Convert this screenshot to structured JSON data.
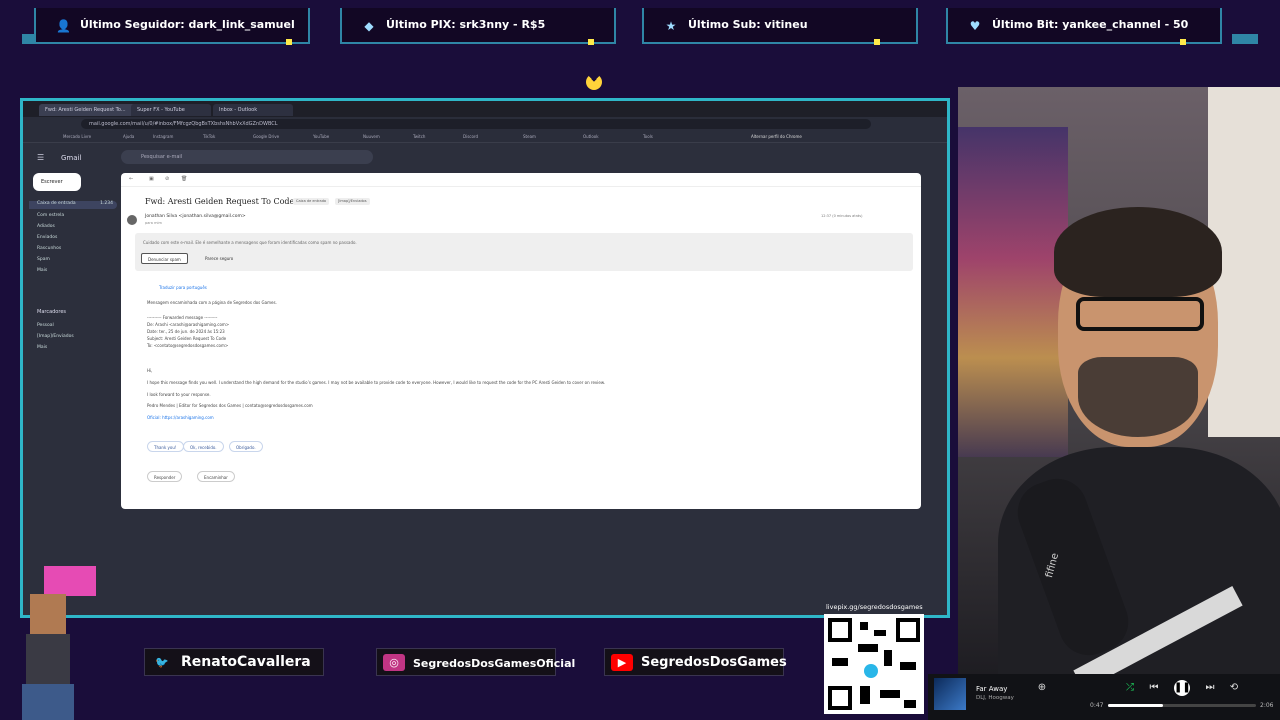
{
  "overlay": {
    "tickers": [
      {
        "icon": "user-icon",
        "glyph": "👤",
        "text": "Último Seguidor: dark_link_samuel"
      },
      {
        "icon": "pix-icon",
        "glyph": "◆",
        "text": "Último PIX: srk3nny - R$5"
      },
      {
        "icon": "star-icon",
        "glyph": "★",
        "text": "Último Sub: vitineu"
      },
      {
        "icon": "heart-icon",
        "glyph": "♥",
        "text": "Último Bit: yankee_channel - 50"
      }
    ]
  },
  "browser": {
    "tabs": [
      "Fwd: Aresti Geiden Request To...",
      "Super FX - YouTube",
      "Inbox - Outlook"
    ],
    "url": "mail.google.com/mail/u/0/#inbox/FMfcgzQbgBsTXbshsNhbVxXdGZnDWBCL",
    "bookmarks": [
      "Mercado Livre",
      "Ajuda",
      "Instagram",
      "TikTok",
      "Google Drive",
      "YouTube",
      "Nuuvem",
      "Twitch",
      "Discord",
      "Steam",
      "Outlook",
      "Tools"
    ],
    "side_note": "Alternar perfil do Chrome"
  },
  "gmail": {
    "logo": "Gmail",
    "search_placeholder": "Pesquisar e-mail",
    "compose": "Escrever",
    "sidebar": [
      "Caixa de entrada",
      "Com estrela",
      "Adiados",
      "Enviados",
      "Rascunhos",
      "Spam",
      "Mais"
    ],
    "inbox_count": "1.234",
    "labels_title": "Marcadores",
    "labels": [
      "Pessoal",
      "[Imap]/Enviados",
      "Mais"
    ],
    "subject": "Fwd: Aresti Geiden Request To Code",
    "chips": [
      "Caixa de entrada",
      "[Imap]/Enviados"
    ],
    "sender": "Jonathan Silva <jonathan.silva@gmail.com>",
    "sender_sub": "para mim",
    "date": "12:37 (0 minutos atrás)",
    "spam_warning": "Cuidado com este e-mail. Ele é semelhante a mensagens que foram identificadas como spam no passado.",
    "spam_buttons": [
      "Denunciar spam",
      "Parece seguro"
    ],
    "translate": "Traduzir para português",
    "body": [
      "Mensagem encaminhada com a página de Segredos dos Games.",
      "---------- Forwarded message ---------",
      "De: Arashi <arashi@arashigaming.com>",
      "Date: ter., 25 de jun. de 2024 às 15:23",
      "Subject: Aresti Geiden Request To Code",
      "To: <contato@segredosdosgames.com>",
      "Hi,",
      "I hope this message finds you well. I understand the high demand for the studio’s games. I may not be available to provide code to everyone. However, I would like to request the code for the PC Aresti Geiden to cover on review.",
      "I look forward to your response.",
      "Pedro Mendes | Editor for Segredos dos Games | contato@segredosdosgames.com",
      "Oficial: https://arashigaming.com"
    ],
    "suggestions": [
      "Thank you!",
      "Ok, recebido.",
      "Obrigado."
    ],
    "reply_buttons": [
      "Responder",
      "Encaminhar"
    ]
  },
  "socials": [
    {
      "icon": "twitter-icon",
      "glyph": "🐦",
      "color": "#1d9bf0",
      "name": "RenatoCavallera"
    },
    {
      "icon": "instagram-icon",
      "glyph": "◎",
      "color": "#c13584",
      "name": "SegredosDosGamesOficial"
    },
    {
      "icon": "youtube-icon",
      "glyph": "▶",
      "color": "#ff0000",
      "name": "SegredosDosGames"
    }
  ],
  "qr": {
    "label": "livepix.gg/segredosdosgames"
  },
  "player": {
    "song": "Far Away",
    "artist": "DLJ, Hoogway",
    "elapsed": "0:47",
    "duration": "2:06",
    "progress": 0.37
  },
  "cam": {
    "mic_brand": "fifine"
  }
}
